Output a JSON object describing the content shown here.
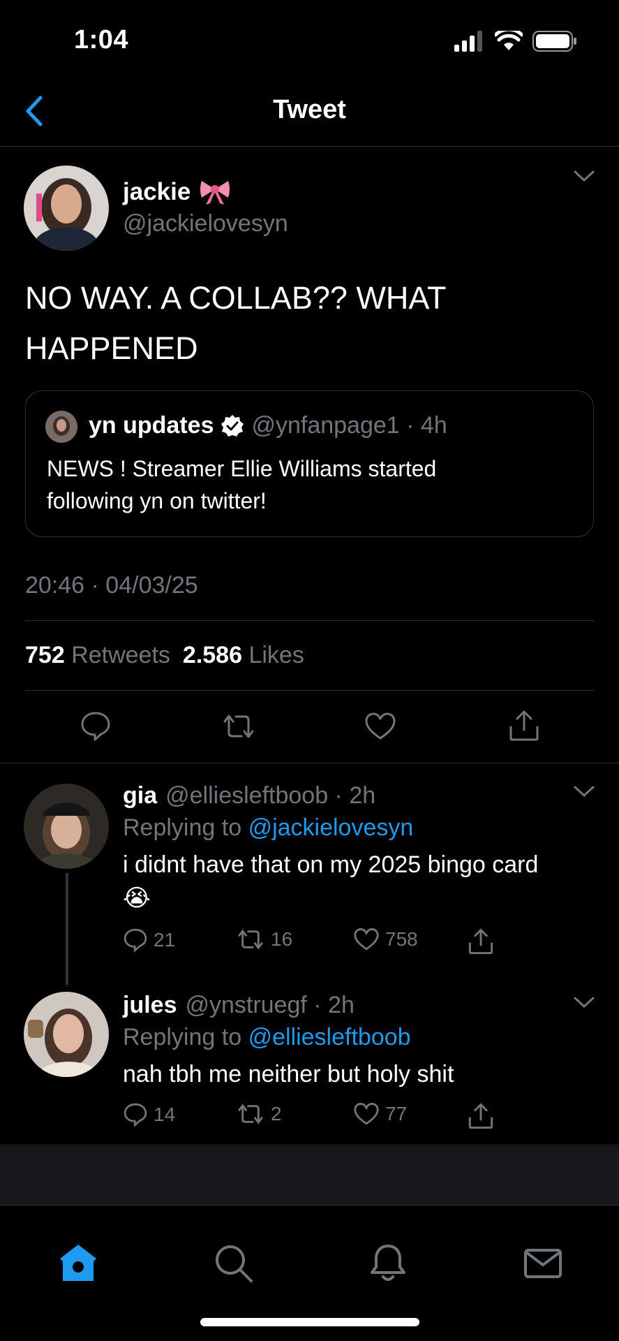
{
  "status": {
    "time": "1:04"
  },
  "nav": {
    "title": "Tweet"
  },
  "main_tweet": {
    "name": "jackie",
    "name_emoji": "🎀",
    "handle": "@jackielovesyn",
    "text_line1": "NO WAY. A COLLAB?? WHAT",
    "text_line2": "HAPPENED",
    "quote": {
      "name": "yn updates",
      "handle_time": "@ynfanpage1 · 4h",
      "text_line1": "NEWS ! Streamer Ellie Williams started",
      "text_line2": "following yn on twitter!"
    },
    "timestamp": "20:46 · 04/03/25",
    "retweets_count": "752",
    "retweets_label": "Retweets",
    "likes_count": "2.586",
    "likes_label": "Likes"
  },
  "replies": [
    {
      "name": "gia",
      "handle_time": "@elliesleftboob · 2h",
      "replying_prefix": "Replying to",
      "replying_to": "@jackielovesyn",
      "text_line1": "i didnt have that on my 2025 bingo card",
      "text_line2": "😭",
      "replies": "21",
      "retweets": "16",
      "likes": "758"
    },
    {
      "name": "jules",
      "handle_time": "@ynstruegf · 2h",
      "replying_prefix": "Replying to",
      "replying_to": "@elliesleftboob",
      "text_line1": "nah tbh me neither but holy shit",
      "replies": "14",
      "retweets": "2",
      "likes": "77"
    }
  ],
  "colors": {
    "accent": "#1d9bf0",
    "muted": "#71767b",
    "border": "#2f3336",
    "background": "#000000"
  },
  "tabbar": {
    "items": [
      "home-icon",
      "search-icon",
      "notifications-icon",
      "messages-icon"
    ]
  }
}
